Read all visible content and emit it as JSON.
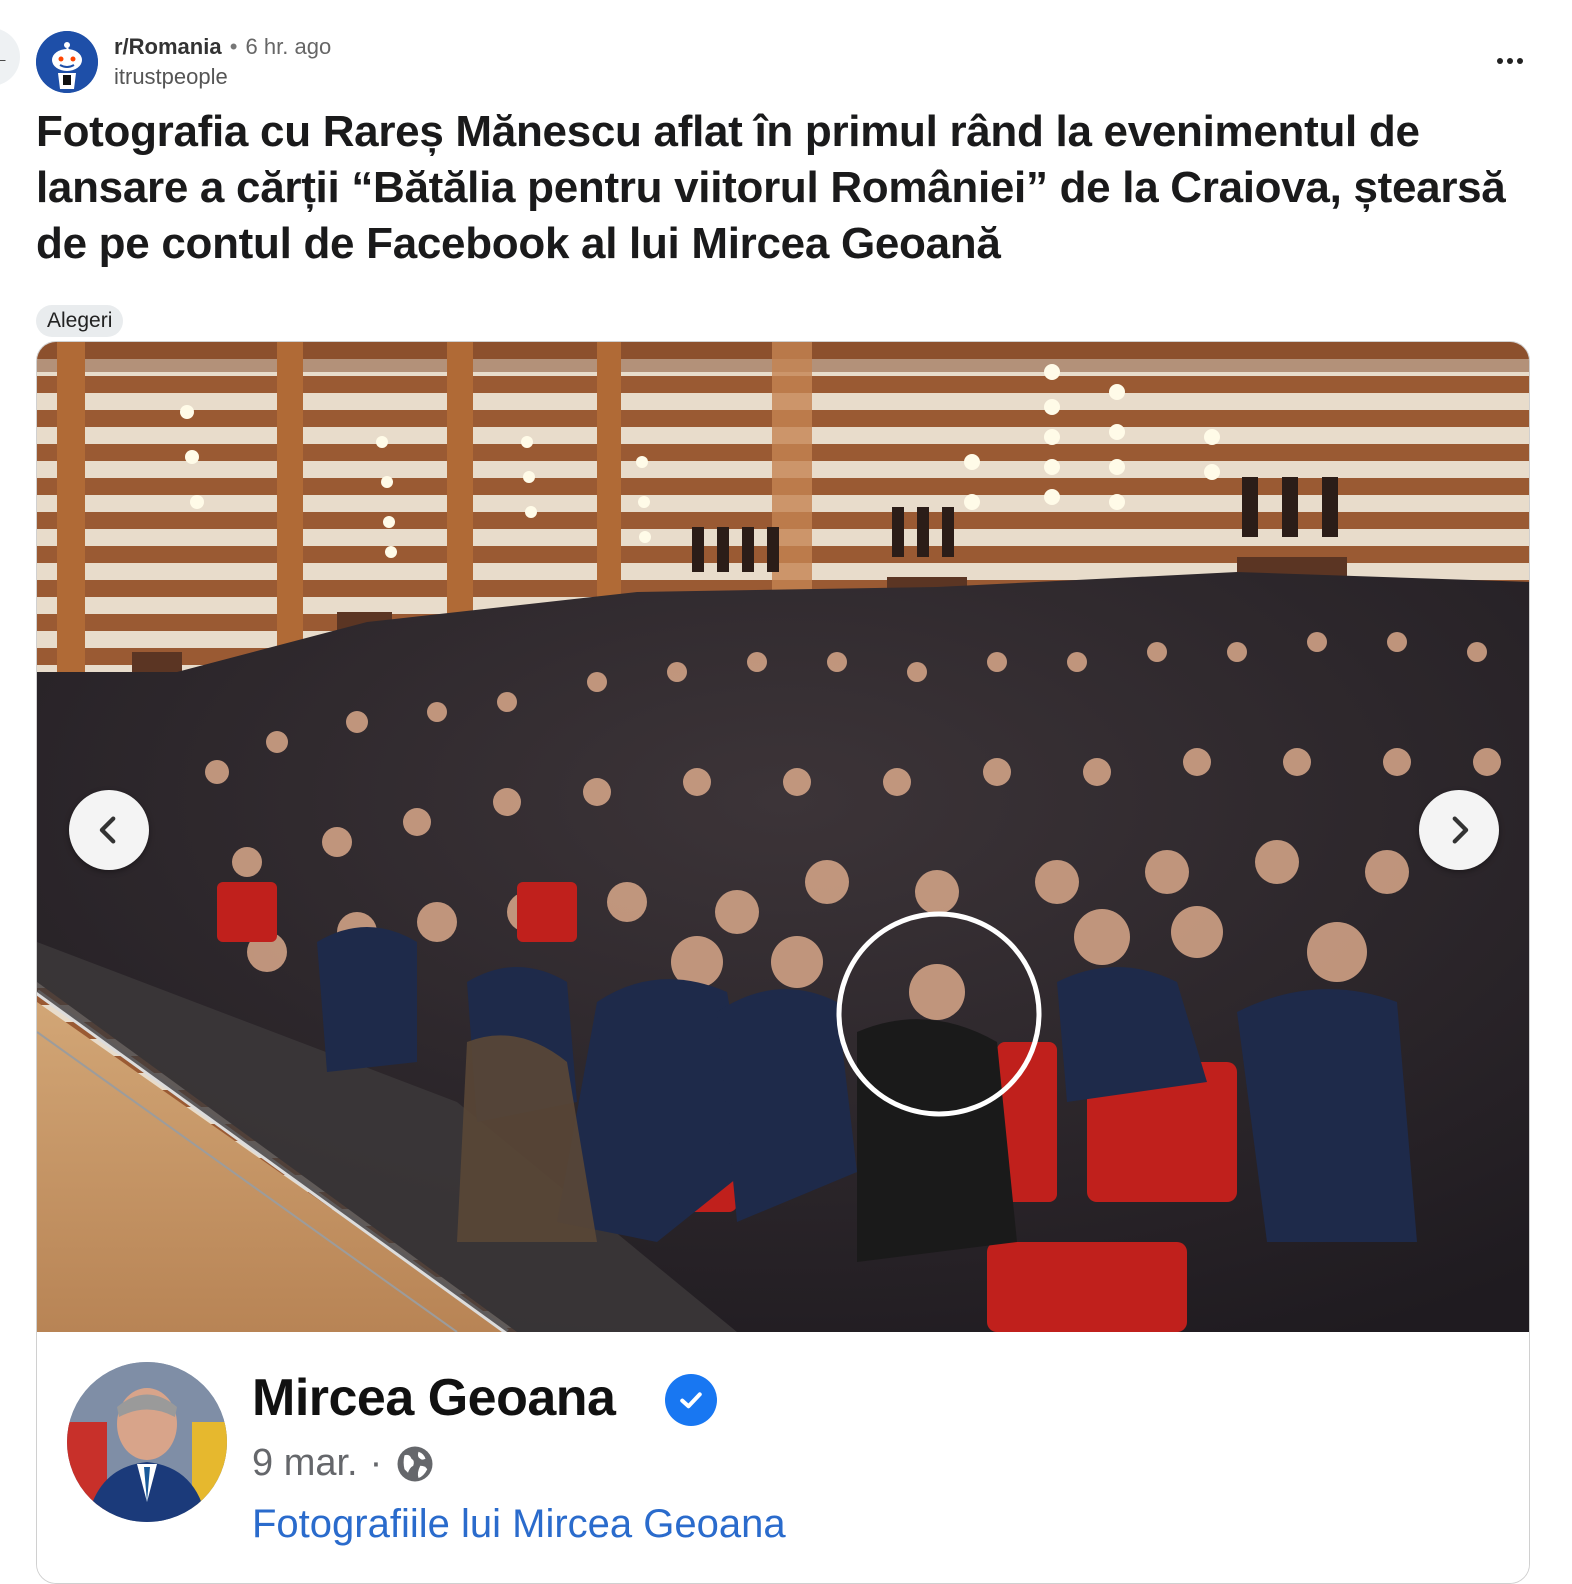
{
  "post": {
    "subreddit": "r/Romania",
    "separator": "•",
    "time": "6 hr. ago",
    "username": "itrustpeople",
    "title": "Fotografia cu Rareș Mănescu aflat în primul rând la evenimentul de lansare a cărții “Bătălia pentru viitorul României” de la Craiova, ștearsă de pe contul de Facebook al lui Mircea Geoană",
    "flair": "Alegeri"
  },
  "facebook_card": {
    "name": "Mircea Geoana",
    "date": "9 mar.",
    "date_separator": "·",
    "album_link": "Fotografiile lui Mircea Geoana"
  },
  "icons": {
    "more": "more-options-icon",
    "prev": "chevron-left-icon",
    "next": "chevron-right-icon",
    "verified": "verified-badge-icon",
    "globe": "globe-icon"
  },
  "colors": {
    "link_blue": "#2a6bcc",
    "verified_blue": "#1877f2",
    "seat_red": "#c0201c"
  }
}
